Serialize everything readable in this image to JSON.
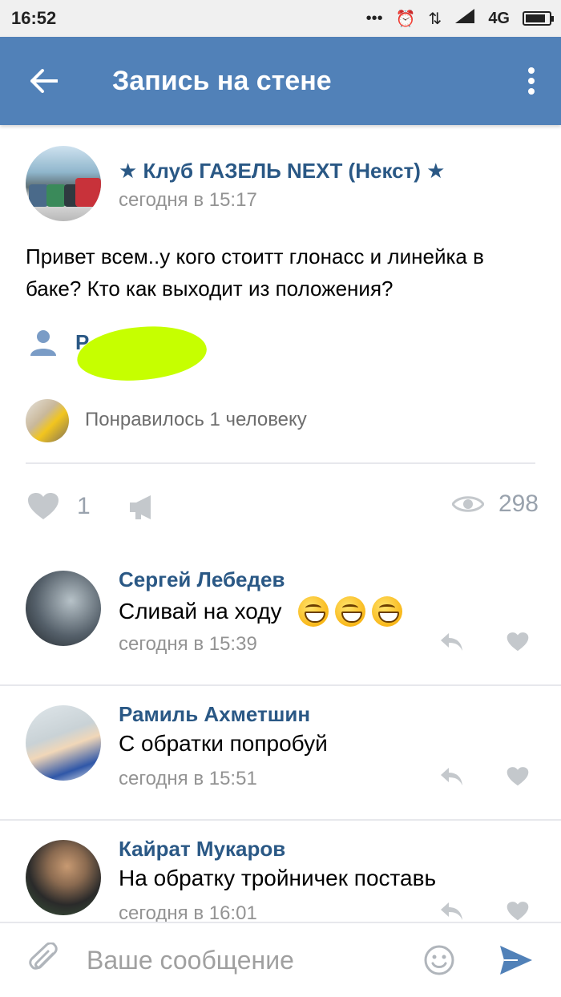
{
  "status_bar": {
    "time": "16:52",
    "network": "4G",
    "battery_level": 0.85
  },
  "app_bar": {
    "title": "Запись на стене"
  },
  "post": {
    "author": "★ Клуб ГАЗЕЛЬ NEXT (Некст) ★",
    "date": "сегодня в 15:17",
    "text": "Привет всем..у кого стоитт глонасс и линейка в баке? Кто как выходит из положения?",
    "signer_visible": "Р         нов",
    "likers_text": "Понравилось 1 человеку",
    "likes_count": "1",
    "views_count": "298"
  },
  "comments": [
    {
      "name": "Сергей Лебедев",
      "text": "Сливай на ходу",
      "emoji_count": 3,
      "date": "сегодня в 15:39"
    },
    {
      "name": "Рамиль Ахметшин",
      "text": "С обратки попробуй",
      "emoji_count": 0,
      "date": "сегодня в 15:51"
    },
    {
      "name": "Кайрат Мукаров",
      "text": "На обратку тройничек поставь",
      "emoji_count": 0,
      "date": "сегодня в 16:01"
    }
  ],
  "composer": {
    "placeholder": "Ваше сообщение"
  },
  "colors": {
    "app_bar": "#5181b8",
    "link": "#2a5885",
    "secondary_text": "#939393",
    "icon_gray": "#c4c8cc",
    "redaction": "#c6ff00"
  }
}
